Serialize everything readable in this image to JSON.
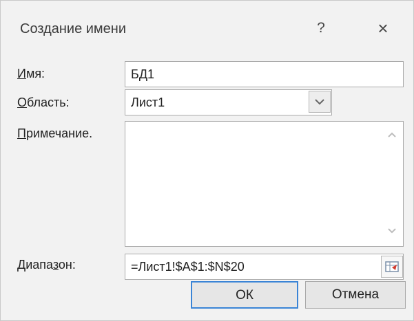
{
  "dialog": {
    "title": "Создание имени",
    "help_label": "?",
    "close_label": "×"
  },
  "fields": {
    "name": {
      "label_ul": "И",
      "label_rest": "мя:",
      "value": "БД1"
    },
    "scope": {
      "label_ul": "О",
      "label_rest": "бласть:",
      "value": "Лист1"
    },
    "comment": {
      "label_ul": "П",
      "label_rest": "римечание.",
      "value": ""
    },
    "range": {
      "label_pre": "Диапа",
      "label_ul": "з",
      "label_post": "он:",
      "value": "=Лист1!$A$1:$N$20"
    }
  },
  "buttons": {
    "ok": "ОК",
    "cancel": "Отмена"
  },
  "colors": {
    "ok_border": "#3a84d6",
    "dialog_bg": "#f2f2f2"
  },
  "icons": {
    "scope_dropdown": "chevron-down-icon",
    "scroll_up": "chevron-up-icon",
    "scroll_down": "chevron-down-icon",
    "range_collapse": "range-select-icon"
  }
}
